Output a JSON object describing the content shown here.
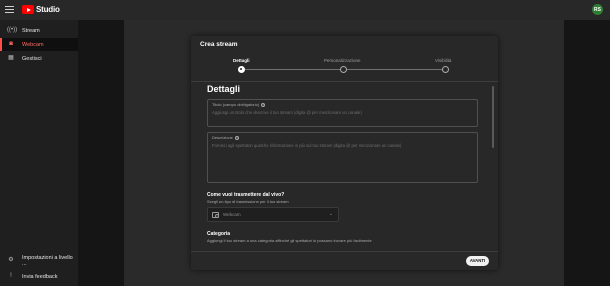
{
  "header": {
    "logo_text": "Studio",
    "avatar_initials": "RS",
    "avatar_color": "#2e7d32",
    "brand_color": "#ff0000"
  },
  "sidebar": {
    "items": [
      {
        "label": "Stream",
        "icon": "stream-icon"
      },
      {
        "label": "Webcam",
        "icon": "webcam-icon"
      },
      {
        "label": "Gestisci",
        "icon": "calendar-icon"
      }
    ],
    "bottom_items": [
      {
        "label": "Impostazioni a livello ...",
        "icon": "gear-icon"
      },
      {
        "label": "Invia feedback",
        "icon": "feedback-icon"
      }
    ]
  },
  "dialog": {
    "title": "Crea stream",
    "steps": [
      "Dettagli",
      "Personalizzazione",
      "Visibilità"
    ],
    "current_step": "Dettagli",
    "section_title": "Dettagli",
    "title_field": {
      "label": "Titolo (campo obbligatorio)",
      "placeholder": "Aggiungi un titolo che descrive il tuo stream (digita @ per menzionare un canale)"
    },
    "description_field": {
      "label": "Descrizione",
      "placeholder": "Fornisci agli spettatori qualche informazione in più sul tuo stream (digita @ per menzionare un canale)"
    },
    "stream_question": "Come vuoi trasmettere dal vivo?",
    "stream_question_sub": "Scegli un tipo di trasmissione per il tuo stream",
    "stream_select_value": "Webcam",
    "category_title": "Categoria",
    "category_sub": "Aggiungi il tuo stream a una categoria affinché gli spettatori lo possano trovare più facilmente",
    "next_button": "AVANTI"
  }
}
